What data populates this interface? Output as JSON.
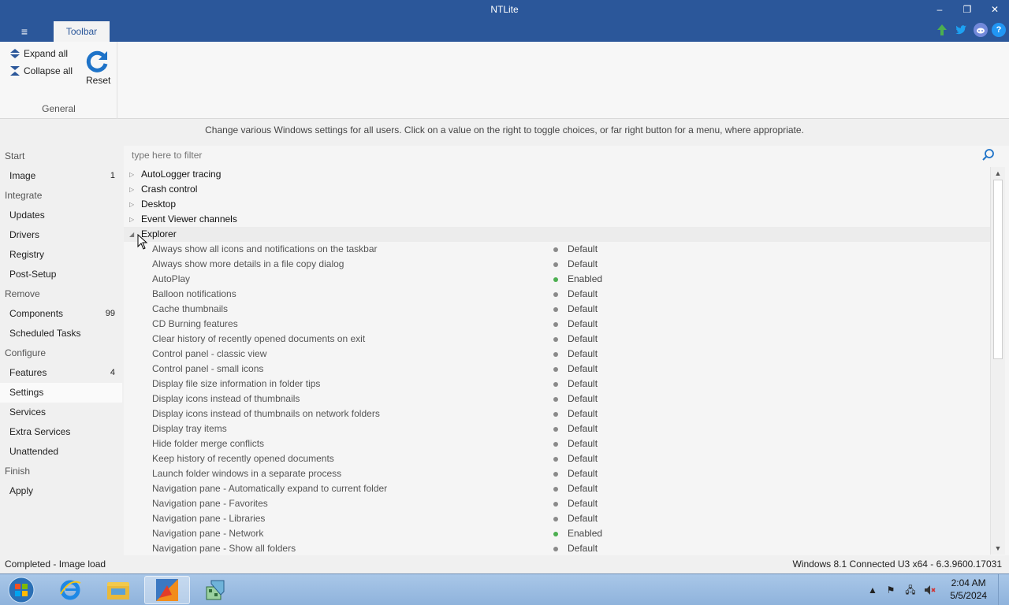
{
  "window": {
    "title": "NTLite",
    "minimize": "–",
    "restore": "❐",
    "close": "✕"
  },
  "menu": {
    "hamburger": "≡"
  },
  "tabs": {
    "toolbar": "Toolbar"
  },
  "ribbon": {
    "expand_all": "Expand all",
    "collapse_all": "Collapse all",
    "reset": "Reset",
    "group_label": "General"
  },
  "description": "Change various Windows settings for all users. Click on a value on the right to toggle choices, or far right button for a menu, where appropriate.",
  "sidebar": {
    "start": "Start",
    "image": "Image",
    "image_count": "1",
    "integrate": "Integrate",
    "updates": "Updates",
    "drivers": "Drivers",
    "registry": "Registry",
    "post_setup": "Post-Setup",
    "remove": "Remove",
    "components": "Components",
    "components_count": "99",
    "scheduled_tasks": "Scheduled Tasks",
    "configure": "Configure",
    "features": "Features",
    "features_count": "4",
    "settings": "Settings",
    "services": "Services",
    "extra_services": "Extra Services",
    "unattended": "Unattended",
    "finish": "Finish",
    "apply": "Apply"
  },
  "filter": {
    "placeholder": "type here to filter"
  },
  "tree": {
    "collapsed_groups": [
      "AutoLogger tracing",
      "Crash control",
      "Desktop",
      "Event Viewer channels"
    ],
    "expanded_group": "Explorer",
    "items": [
      {
        "label": "Always show all icons and notifications on the taskbar",
        "value": "Default",
        "color": "#8a8a8a"
      },
      {
        "label": "Always show more details in a file copy dialog",
        "value": "Default",
        "color": "#8a8a8a"
      },
      {
        "label": "AutoPlay",
        "value": "Enabled",
        "color": "#4caf50"
      },
      {
        "label": "Balloon notifications",
        "value": "Default",
        "color": "#8a8a8a"
      },
      {
        "label": "Cache thumbnails",
        "value": "Default",
        "color": "#8a8a8a"
      },
      {
        "label": "CD Burning features",
        "value": "Default",
        "color": "#8a8a8a"
      },
      {
        "label": "Clear history of recently opened documents on exit",
        "value": "Default",
        "color": "#8a8a8a"
      },
      {
        "label": "Control panel - classic view",
        "value": "Default",
        "color": "#8a8a8a"
      },
      {
        "label": "Control panel - small icons",
        "value": "Default",
        "color": "#8a8a8a"
      },
      {
        "label": "Display file size information in folder tips",
        "value": "Default",
        "color": "#8a8a8a"
      },
      {
        "label": "Display icons instead of thumbnails",
        "value": "Default",
        "color": "#8a8a8a"
      },
      {
        "label": "Display icons instead of thumbnails on network folders",
        "value": "Default",
        "color": "#8a8a8a"
      },
      {
        "label": "Display tray items",
        "value": "Default",
        "color": "#8a8a8a"
      },
      {
        "label": "Hide folder merge conflicts",
        "value": "Default",
        "color": "#8a8a8a"
      },
      {
        "label": "Keep history of recently opened documents",
        "value": "Default",
        "color": "#8a8a8a"
      },
      {
        "label": "Launch folder windows in a separate process",
        "value": "Default",
        "color": "#8a8a8a"
      },
      {
        "label": "Navigation pane - Automatically expand to current folder",
        "value": "Default",
        "color": "#8a8a8a"
      },
      {
        "label": "Navigation pane - Favorites",
        "value": "Default",
        "color": "#8a8a8a"
      },
      {
        "label": "Navigation pane - Libraries",
        "value": "Default",
        "color": "#8a8a8a"
      },
      {
        "label": "Navigation pane - Network",
        "value": "Enabled",
        "color": "#4caf50"
      },
      {
        "label": "Navigation pane - Show all folders",
        "value": "Default",
        "color": "#8a8a8a"
      }
    ]
  },
  "status": {
    "left": "Completed - Image load",
    "right": "Windows 8.1 Connected U3 x64 - 6.3.9600.17031"
  },
  "taskbar": {
    "time": "2:04 AM",
    "date": "5/5/2024"
  },
  "colors": {
    "accent": "#2b579a",
    "enabled": "#4caf50",
    "default_dot": "#8a8a8a"
  }
}
